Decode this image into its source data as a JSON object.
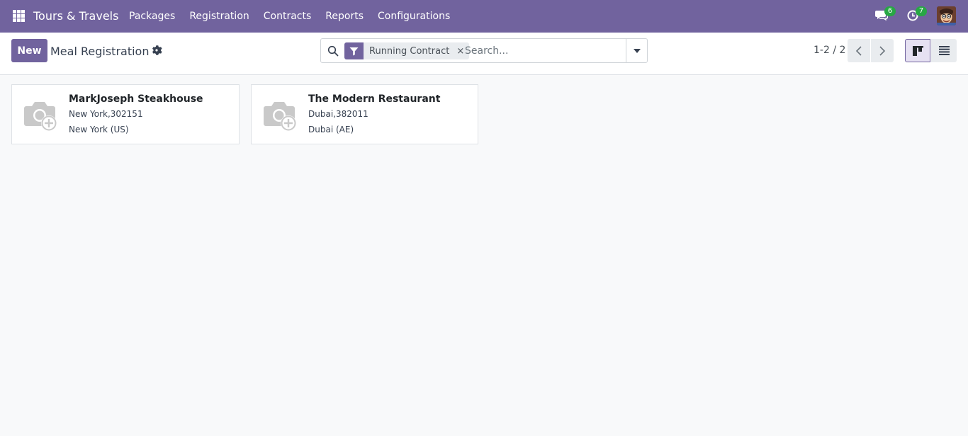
{
  "navbar": {
    "brand": "Tours & Travels",
    "menu": [
      "Packages",
      "Registration",
      "Contracts",
      "Reports",
      "Configurations"
    ],
    "messages_count": "6",
    "activities_count": "7",
    "background_color": "#71639e"
  },
  "control": {
    "new_label": "New",
    "title": "Meal Registration",
    "facet_label": "Running Contract",
    "facet_close": "×",
    "search_placeholder": "Search...",
    "pager_value": "1-2 / 2"
  },
  "cards": [
    {
      "name": "MarkJoseph Steakhouse",
      "line1": "New York,302151",
      "line2": "New York (US)"
    },
    {
      "name": "The Modern Restaurant",
      "line1": "Dubai,382011",
      "line2": "Dubai (AE)"
    }
  ],
  "icons": [
    "apps-grid-icon",
    "chat-icon",
    "clock-icon",
    "gear-icon",
    "search-icon",
    "filter-icon",
    "caret-down-icon",
    "chevron-left-icon",
    "chevron-right-icon",
    "kanban-view-icon",
    "list-view-icon",
    "camera-placeholder-icon"
  ]
}
